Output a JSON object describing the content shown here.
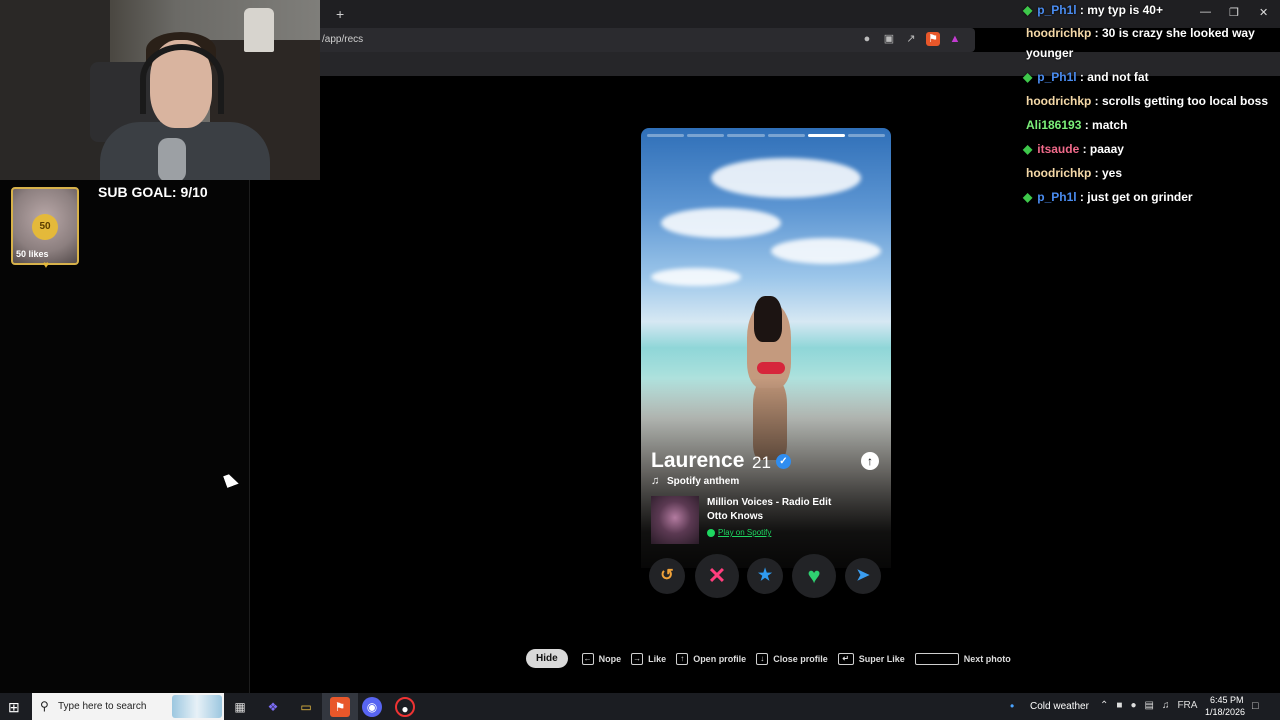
{
  "browser": {
    "url": "/app/recs",
    "new_tab_label": "+"
  },
  "stream": {
    "likes_badge_value": "50",
    "likes_label": "50 likes",
    "sub_goal": "SUB GOAL: 9/10"
  },
  "profile": {
    "name": "Laurence",
    "age": "21",
    "anthem_label": "Spotify anthem",
    "track": "Million Voices - Radio Edit",
    "artist": "Otto Knows",
    "spotify_link": "Play on Spotify",
    "photo_count": 6,
    "current_photo_index": 4
  },
  "actions": {
    "rewind_icon": "rewind-icon",
    "nope_icon": "close-icon",
    "superlike_icon": "star-icon",
    "like_icon": "heart-icon",
    "boost_icon": "send-icon",
    "colors": {
      "rewind": "#f0a23a",
      "nope": "#ff3e7d",
      "superlike": "#2f9bf0",
      "like": "#2fd070",
      "boost": "#3a9df0"
    }
  },
  "hints": {
    "hide": "Hide",
    "nope": "Nope",
    "like": "Like",
    "open_profile": "Open profile",
    "close_profile": "Close profile",
    "super_like": "Super Like",
    "next_photo": "Next photo"
  },
  "chat": [
    {
      "user": "p_Ph1l",
      "color": "#4a8cf0",
      "badge": true,
      "message": "my typ is 40+"
    },
    {
      "user": "hoodrichkp",
      "color": "#f5d9a8",
      "badge": false,
      "message": "30 is crazy she looked way younger"
    },
    {
      "user": "p_Ph1l",
      "color": "#4a8cf0",
      "badge": true,
      "message": "and not fat"
    },
    {
      "user": "hoodrichkp",
      "color": "#f5d9a8",
      "badge": false,
      "message": "scrolls getting too local boss"
    },
    {
      "user": "Ali186193",
      "color": "#7cf07a",
      "badge": false,
      "message": "match"
    },
    {
      "user": "itsaude",
      "color": "#f06a8a",
      "badge": true,
      "message": "paaay"
    },
    {
      "user": "hoodrichkp",
      "color": "#f5d9a8",
      "badge": false,
      "message": "yes"
    },
    {
      "user": "p_Ph1l",
      "color": "#4a8cf0",
      "badge": true,
      "message": "just get on grinder"
    }
  ],
  "taskbar": {
    "search_placeholder": "Type here to search",
    "weather": "Cold weather",
    "lang": "FRA",
    "time": "6:45 PM",
    "date": "1/18/2026"
  }
}
